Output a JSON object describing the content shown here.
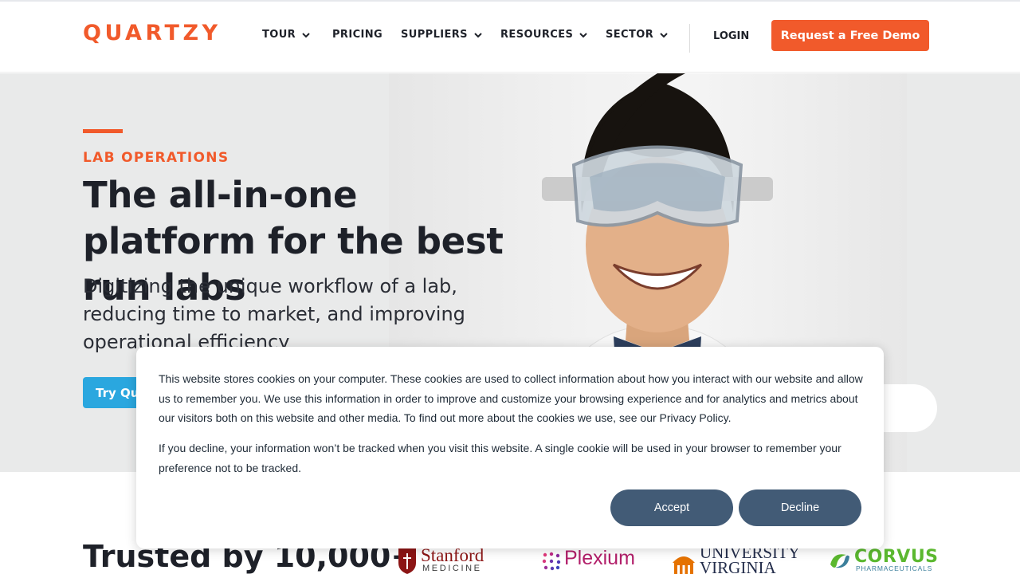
{
  "brand": {
    "logo_text": "QUARTZY",
    "accent": "#f15a2b",
    "blue": "#2aa7df"
  },
  "nav": {
    "items": [
      {
        "label": "TOUR",
        "dropdown": true
      },
      {
        "label": "PRICING",
        "dropdown": false
      },
      {
        "label": "SUPPLIERS",
        "dropdown": true
      },
      {
        "label": "RESOURCES",
        "dropdown": true
      },
      {
        "label": "SECTOR",
        "dropdown": true
      }
    ],
    "login": "LOGIN",
    "demo_button": "Request a Free Demo"
  },
  "hero": {
    "eyebrow": "LAB OPERATIONS",
    "title": "The all-in-one platform for the best run labs",
    "subtitle": "Digitizing the unique workflow of a lab, reducing time to market, and improving operational efficiency",
    "try_button": "Try Quartzy"
  },
  "trusted": {
    "heading": "Trusted by 10,000+",
    "logos": {
      "stanford": {
        "name": "Stanford",
        "sub": "MEDICINE"
      },
      "plexium": {
        "name": "Plexium"
      },
      "uva": {
        "line1": "UNIVERSITY",
        "line2": "VIRGINIA"
      },
      "corvus": {
        "name": "CORVUS",
        "sub": "PHARMACEUTICALS"
      }
    }
  },
  "cookie_banner": {
    "paragraph1": "This website stores cookies on your computer. These cookies are used to collect information about how you interact with our website and allow us to remember you. We use this information in order to improve and customize your browsing experience and for analytics and metrics about our visitors both on this website and other media. To find out more about the cookies we use, see our Privacy Policy.",
    "paragraph2": "If you decline, your information won’t be tracked when you visit this website. A single cookie will be used in your browser to remember your preference not to be tracked.",
    "accept": "Accept",
    "decline": "Decline",
    "button_color": "#425b76"
  }
}
